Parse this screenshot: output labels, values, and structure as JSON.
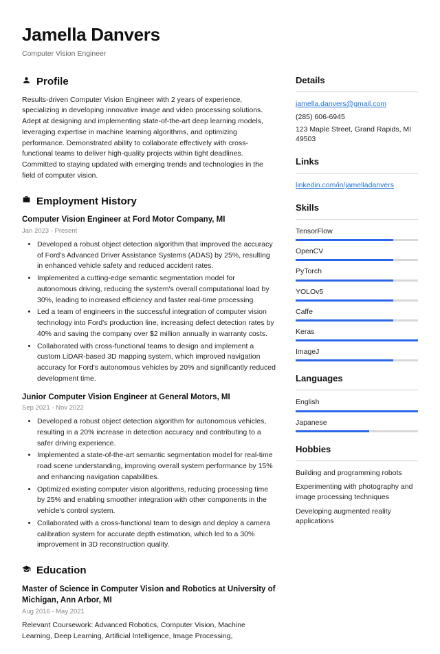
{
  "header": {
    "name": "Jamella Danvers",
    "title": "Computer Vision Engineer"
  },
  "profile": {
    "heading": "Profile",
    "text": "Results-driven Computer Vision Engineer with 2 years of experience, specializing in developing innovative image and video processing solutions. Adept at designing and implementing state-of-the-art deep learning models, leveraging expertise in machine learning algorithms, and optimizing performance. Demonstrated ability to collaborate effectively with cross-functional teams to deliver high-quality projects within tight deadlines. Committed to staying updated with emerging trends and technologies in the field of computer vision."
  },
  "employment": {
    "heading": "Employment History",
    "jobs": [
      {
        "title": "Computer Vision Engineer at Ford Motor Company, MI",
        "dates": "Jan 2023 - Present",
        "bullets": [
          "Developed a robust object detection algorithm that improved the accuracy of Ford's Advanced Driver Assistance Systems (ADAS) by 25%, resulting in enhanced vehicle safety and reduced accident rates.",
          "Implemented a cutting-edge semantic segmentation model for autonomous driving, reducing the system's overall computational load by 30%, leading to increased efficiency and faster real-time processing.",
          "Led a team of engineers in the successful integration of computer vision technology into Ford's production line, increasing defect detection rates by 40% and saving the company over $2 million annually in warranty costs.",
          "Collaborated with cross-functional teams to design and implement a custom LiDAR-based 3D mapping system, which improved navigation accuracy for Ford's autonomous vehicles by 20% and significantly reduced development time."
        ]
      },
      {
        "title": "Junior Computer Vision Engineer at General Motors, MI",
        "dates": "Sep 2021 - Nov 2022",
        "bullets": [
          "Developed a robust object detection algorithm for autonomous vehicles, resulting in a 20% increase in detection accuracy and contributing to a safer driving experience.",
          "Implemented a state-of-the-art semantic segmentation model for real-time road scene understanding, improving overall system performance by 15% and enhancing navigation capabilities.",
          "Optimized existing computer vision algorithms, reducing processing time by 25% and enabling smoother integration with other components in the vehicle's control system.",
          "Collaborated with a cross-functional team to design and deploy a camera calibration system for accurate depth estimation, which led to a 30% improvement in 3D reconstruction quality."
        ]
      }
    ]
  },
  "education": {
    "heading": "Education",
    "degree": "Master of Science in Computer Vision and Robotics at University of Michigan, Ann Arbor, MI",
    "dates": "Aug 2016 - May 2021",
    "text": "Relevant Coursework: Advanced Robotics, Computer Vision, Machine Learning, Deep Learning, Artificial Intelligence, Image Processing,"
  },
  "details": {
    "heading": "Details",
    "email": "jamella.danvers@gmail.com",
    "phone": "(285) 606-6945",
    "address": "123 Maple Street, Grand Rapids, MI 49503"
  },
  "links": {
    "heading": "Links",
    "items": [
      "linkedin.com/in/jamelladanvers"
    ]
  },
  "skills": {
    "heading": "Skills",
    "items": [
      {
        "name": "TensorFlow",
        "level": 80
      },
      {
        "name": "OpenCV",
        "level": 80
      },
      {
        "name": "PyTorch",
        "level": 80
      },
      {
        "name": "YOLOv5",
        "level": 80
      },
      {
        "name": "Caffe",
        "level": 80
      },
      {
        "name": "Keras",
        "level": 100
      },
      {
        "name": "ImageJ",
        "level": 80
      }
    ]
  },
  "languages": {
    "heading": "Languages",
    "items": [
      {
        "name": "English",
        "level": 100
      },
      {
        "name": "Japanese",
        "level": 60
      }
    ]
  },
  "hobbies": {
    "heading": "Hobbies",
    "items": [
      "Building and programming robots",
      "Experimenting with photography and image processing techniques",
      "Developing augmented reality applications"
    ]
  }
}
